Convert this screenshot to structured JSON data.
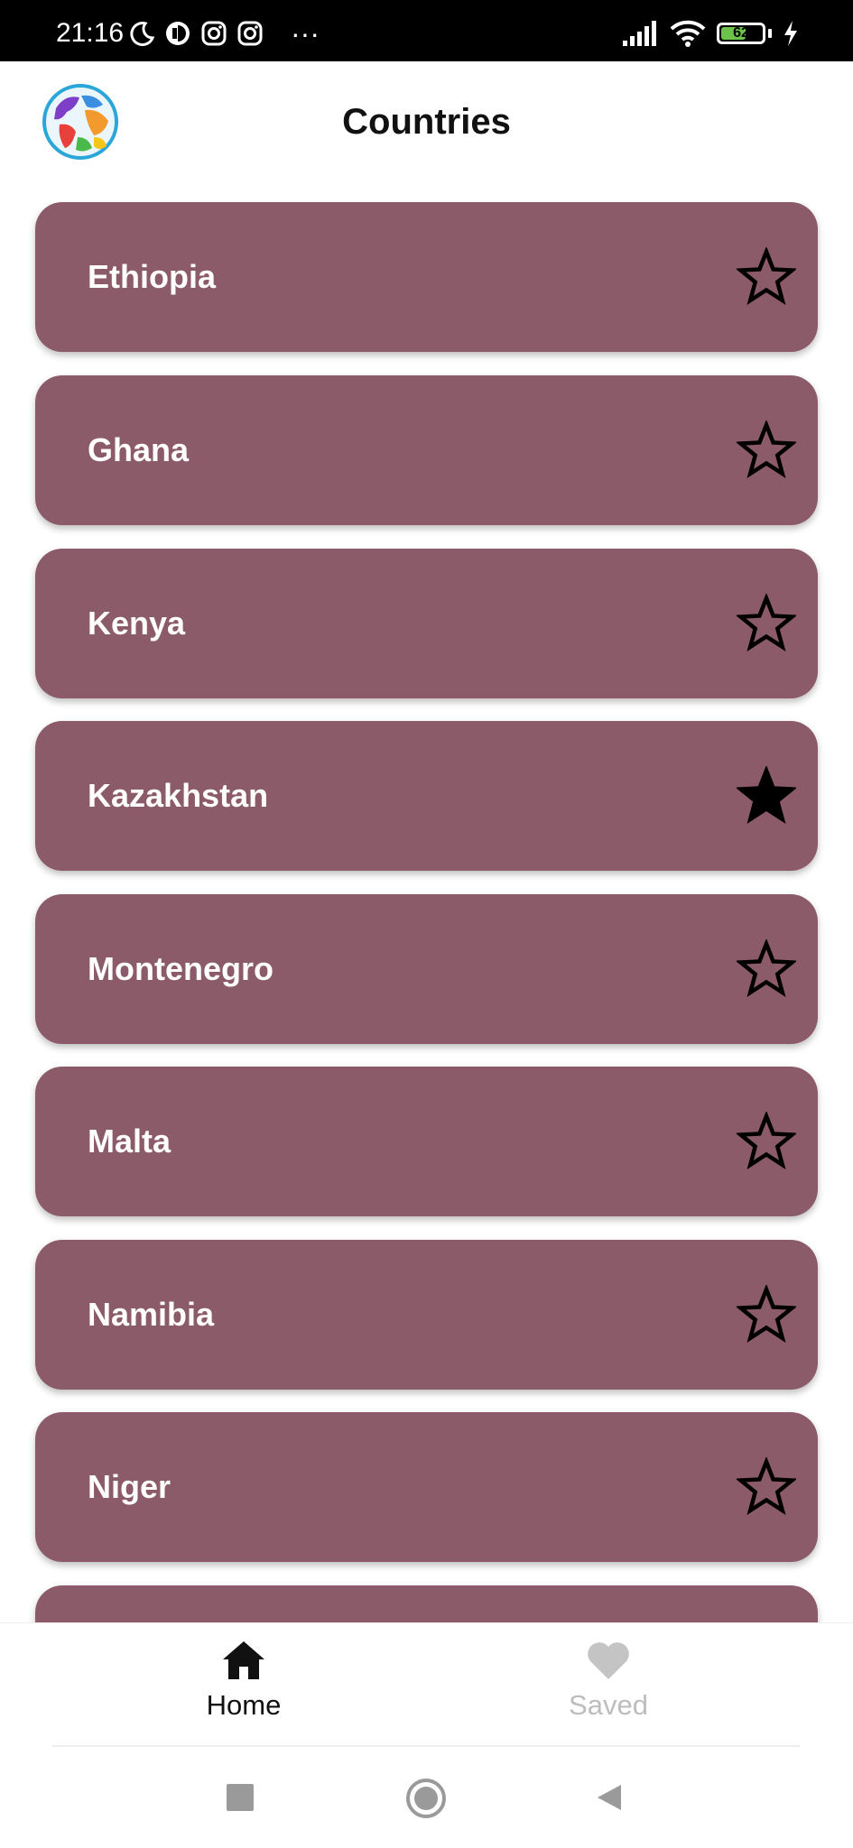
{
  "status_bar": {
    "time": "21:16",
    "battery_level": "62",
    "battery_fraction": 0.62,
    "icons_left": [
      "moon-icon",
      "vpn-icon",
      "instagram-icon",
      "instagram-icon",
      "more-dots-icon"
    ],
    "icons_right": [
      "signal-icon",
      "wifi-icon",
      "battery-icon",
      "charging-icon"
    ],
    "more_dots": "···"
  },
  "header": {
    "title": "Countries",
    "logo": "globe-logo"
  },
  "colors": {
    "card": "#8c5b6a",
    "card_text": "#ffffff",
    "star_outline": "#000000",
    "nav_active": "#111111",
    "nav_inactive": "#bdbdbd",
    "battery_fill": "#6cc24a"
  },
  "countries": [
    {
      "name": "Ethiopia",
      "favorite": false
    },
    {
      "name": "Ghana",
      "favorite": false
    },
    {
      "name": "Kenya",
      "favorite": false
    },
    {
      "name": "Kazakhstan",
      "favorite": true
    },
    {
      "name": "Montenegro",
      "favorite": false
    },
    {
      "name": "Malta",
      "favorite": false
    },
    {
      "name": "Namibia",
      "favorite": false
    },
    {
      "name": "Niger",
      "favorite": false
    },
    {
      "name": "",
      "favorite": false
    }
  ],
  "bottom_nav": {
    "home_label": "Home",
    "saved_label": "Saved",
    "active": "home"
  },
  "system_nav": [
    "recents-square-icon",
    "home-circle-icon",
    "back-triangle-icon"
  ]
}
